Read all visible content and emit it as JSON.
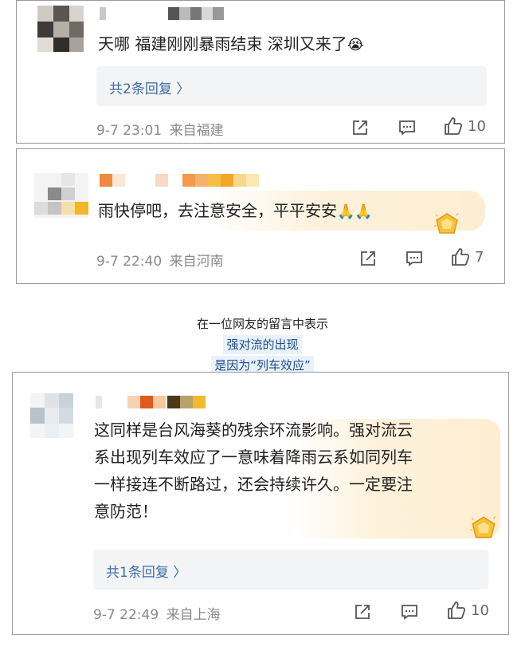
{
  "comments": [
    {
      "text": "天哪 福建刚刚暴雨结束 深圳又来了",
      "emoji": "😭",
      "replies_label": "共2条回复 〉",
      "time": "9-7 23:01",
      "location": "来自福建",
      "likes": "10"
    },
    {
      "text": "雨快停吧，去注意安全，平平安安",
      "emoji": "🙏🙏",
      "time": "9-7 22:40",
      "location": "来自河南",
      "likes": "7"
    },
    {
      "text_lines": [
        "这同样是台风海葵的残余环流影响。强对流云",
        "系出现列车效应了一意味着降雨云系如同列车",
        "一样接连不断路过，还会持续许久。一定要注",
        "意防范！"
      ],
      "replies_label": "共1条回复 〉",
      "time": "9-7 22:49",
      "location": "来自上海",
      "likes": "10"
    }
  ],
  "caption": {
    "line1": "在一位网友的留言中表示",
    "line2": "强对流的出现",
    "line3": "是因为“列车效应”"
  },
  "colors": {
    "reply_link": "#3a6ea8",
    "meta_gray": "#8a8a8a",
    "caption_highlight_bg": "#e9f1fb",
    "caption_highlight_text": "#1a4f8c"
  },
  "icons": [
    "share-icon",
    "comment-icon",
    "like-icon",
    "vip-gem-badge-icon"
  ]
}
